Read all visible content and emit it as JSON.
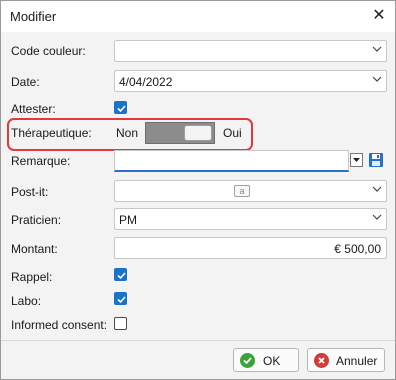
{
  "window": {
    "title": "Modifier",
    "close_glyph": "✕"
  },
  "fields": {
    "code_couleur": {
      "label": "Code couleur:",
      "value": ""
    },
    "date": {
      "label": "Date:",
      "value": "4/04/2022"
    },
    "attester": {
      "label": "Attester:",
      "checked": true
    },
    "therapeutique": {
      "label": "Thérapeutique:",
      "off_label": "Non",
      "on_label": "Oui",
      "state": "on"
    },
    "remarque": {
      "label": "Remarque:",
      "value": ""
    },
    "postit": {
      "label": "Post-it:",
      "icon": "post-it-icon",
      "icon_glyph": "a"
    },
    "praticien": {
      "label": "Praticien:",
      "value": "PM"
    },
    "montant": {
      "label": "Montant:",
      "value": "€ 500,00"
    },
    "rappel": {
      "label": "Rappel:",
      "checked": true
    },
    "labo": {
      "label": "Labo:",
      "checked": true
    },
    "informed_consent": {
      "label": "Informed consent:",
      "checked": false
    }
  },
  "buttons": {
    "ok": "OK",
    "cancel": "Annuler"
  },
  "colors": {
    "accent": "#1a73c9",
    "highlight": "#e03a3a",
    "switch_track": "#8c8c8c",
    "ok": "#3aa23a",
    "cancel": "#d33a3a"
  }
}
